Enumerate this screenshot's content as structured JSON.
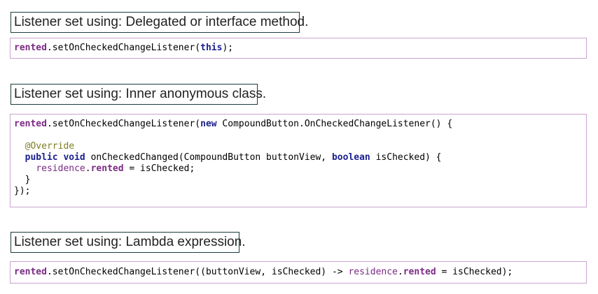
{
  "sections": [
    {
      "heading": "Listener set using: Delegated or interface method.",
      "code": {
        "l1_a": "rented",
        "l1_b": ".setOnCheckedChangeListener(",
        "l1_c": "this",
        "l1_d": ");"
      }
    },
    {
      "heading": "Listener set using: Inner anonymous class.",
      "code": {
        "l1_a": "rented",
        "l1_b": ".setOnCheckedChangeListener(",
        "l1_c": "new",
        "l1_d": " CompoundButton.OnCheckedChangeListener() {",
        "l3_a": "  ",
        "l3_b": "@Override",
        "l4_a": "  ",
        "l4_b": "public",
        "l4_c": " ",
        "l4_d": "void",
        "l4_e": " onCheckedChanged(CompoundButton buttonView, ",
        "l4_f": "boolean",
        "l4_g": " isChecked) {",
        "l5_a": "    ",
        "l5_b": "residence",
        "l5_c": ".",
        "l5_d": "rented",
        "l5_e": " = isChecked;",
        "l6": "  }",
        "l7": "});"
      }
    },
    {
      "heading": "Listener set using: Lambda expression.",
      "code": {
        "l1_a": "rented",
        "l1_b": ".setOnCheckedChangeListener((buttonView, isChecked) -> ",
        "l1_c": "residence",
        "l1_d": ".",
        "l1_e": "rented",
        "l1_f": " = isChecked);"
      }
    }
  ],
  "colors": {
    "keyword": "#1a1f8c",
    "field": "#7b2a84",
    "annotation": "#7d7d20",
    "label_border": "#1c3b3b",
    "code_border": "#c9a3cf"
  }
}
